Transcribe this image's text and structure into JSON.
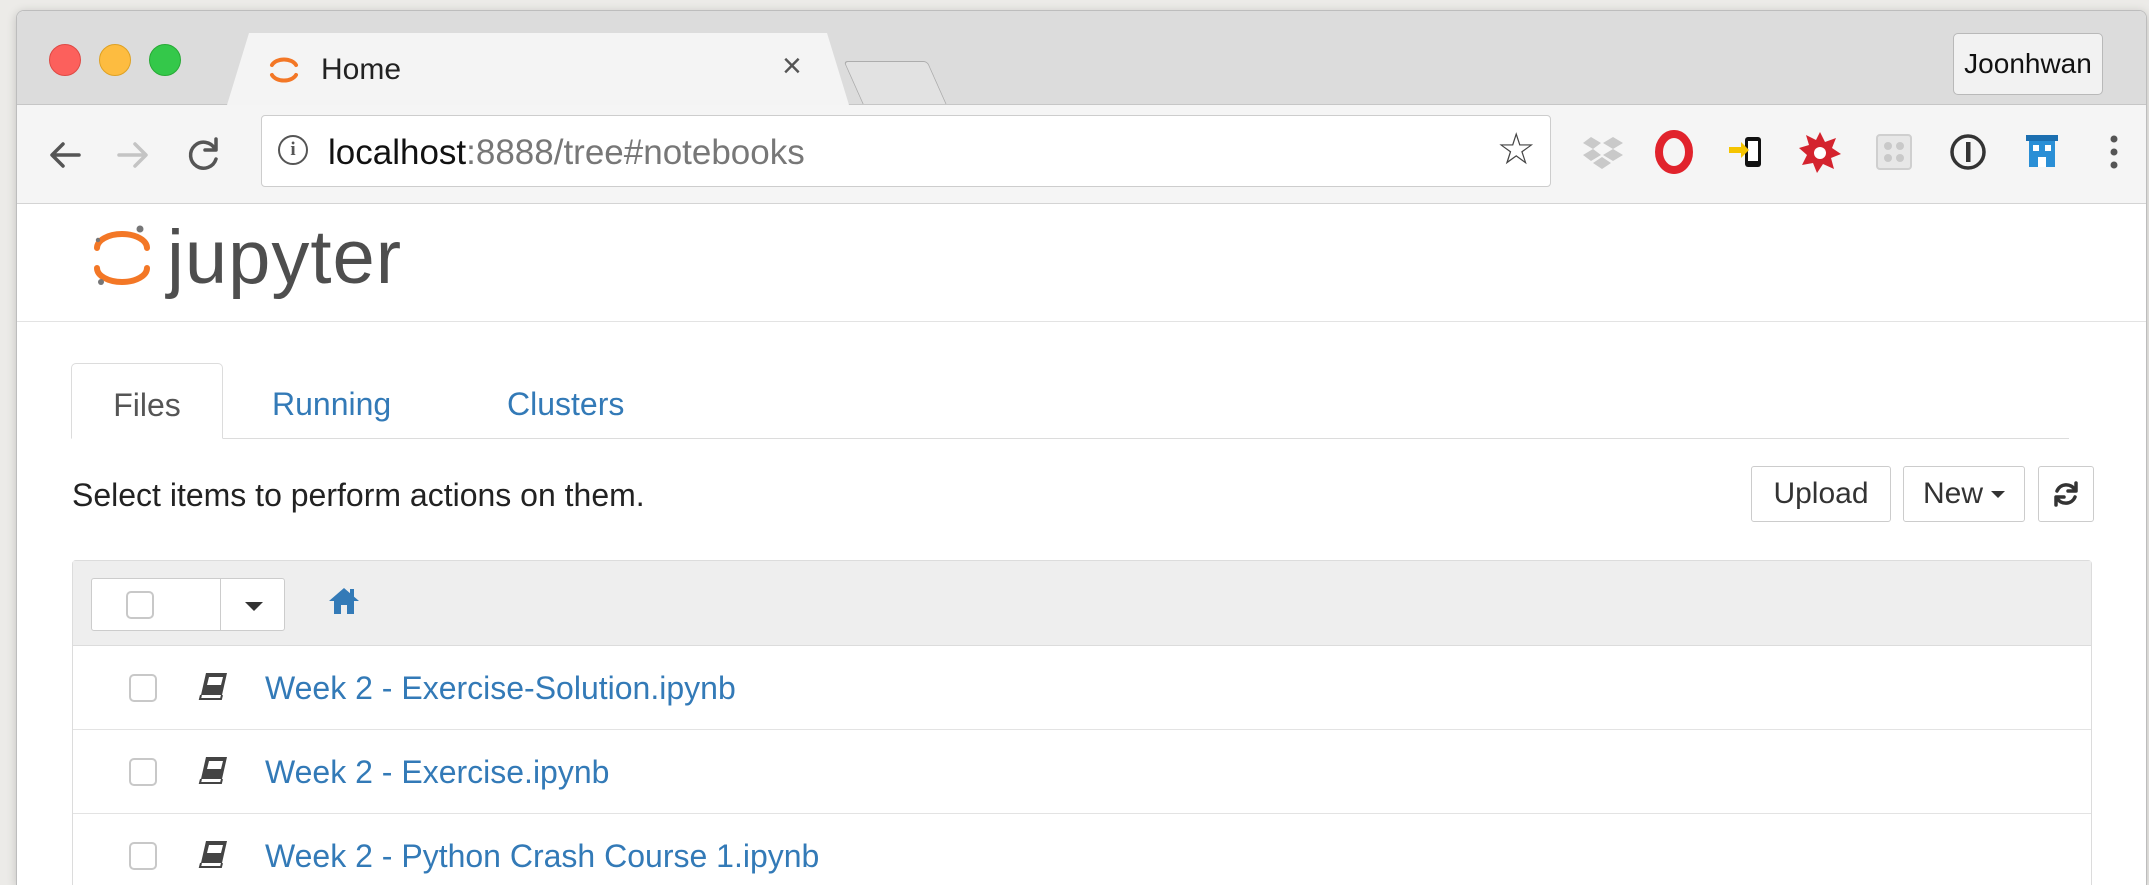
{
  "browser": {
    "tab_title": "Home",
    "tab_close": "×",
    "profile_name": "Joonhwan",
    "url_host": "localhost",
    "url_rest": ":8888/tree#notebooks"
  },
  "jupyter": {
    "logo_text": "jupyter",
    "tabs": [
      {
        "label": "Files",
        "active": true
      },
      {
        "label": "Running"
      },
      {
        "label": "Clusters"
      }
    ],
    "hint": "Select items to perform actions on them.",
    "upload_label": "Upload",
    "new_label": "New",
    "files": [
      {
        "name": "Week 2 - Exercise-Solution.ipynb"
      },
      {
        "name": "Week 2 - Exercise.ipynb"
      },
      {
        "name": "Week 2 - Python Crash Course 1.ipynb"
      }
    ]
  },
  "colors": {
    "link": "#337ab7",
    "jupyter_orange": "#f37726"
  },
  "icons": [
    "back-arrow-icon",
    "forward-arrow-icon",
    "reload-icon",
    "info-icon",
    "star-icon",
    "dropbox-icon",
    "opera-icon",
    "phone-arrow-icon",
    "red-badge-icon",
    "grid-icon",
    "onepassword-icon",
    "building-icon",
    "kebab-menu-icon",
    "home-icon",
    "notebook-icon",
    "refresh-icon",
    "caret-down-icon"
  ]
}
